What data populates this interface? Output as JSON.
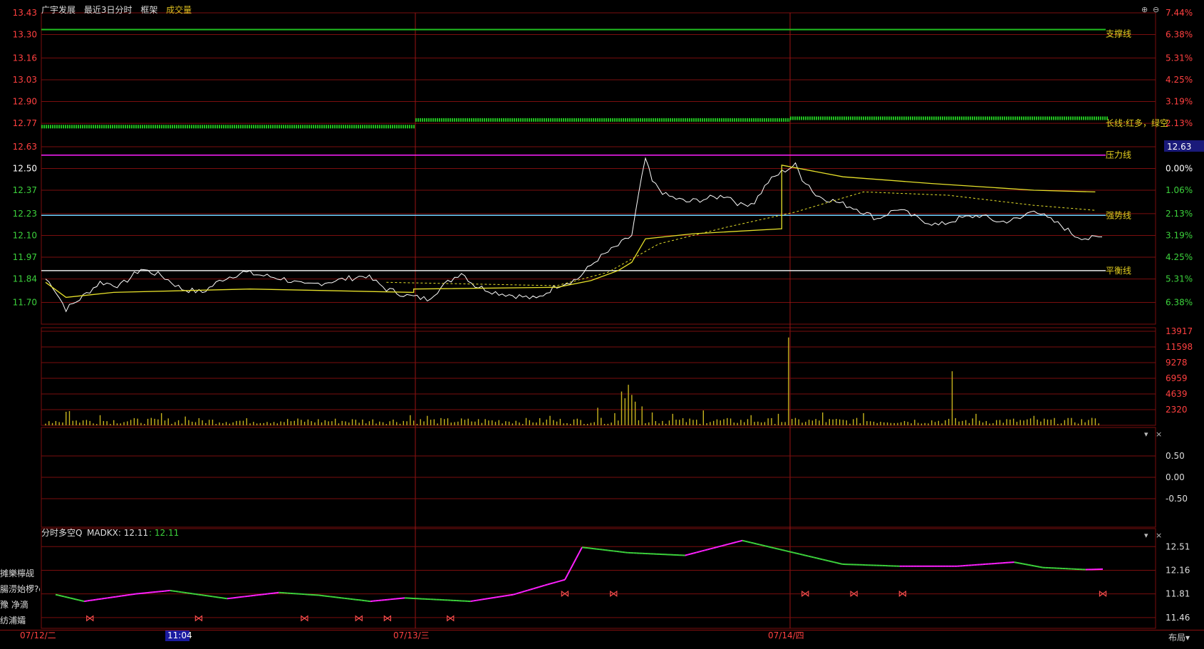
{
  "header": {
    "stock_name": "广宇发展",
    "period": "最近3日分时",
    "frame": "框架",
    "indicator": "成交量",
    "indicator_color": "#e0c020"
  },
  "colors": {
    "up": "#ff4040",
    "down": "#3cd23c",
    "grid": "#7a0e0e",
    "price_line": "#ffffff",
    "avg_line": "#e6e02a",
    "support": "#20c020",
    "pressure": "#ff20ff",
    "strong": "#70d0ff",
    "balance": "#e8e8e8",
    "volume": "#c8b41e"
  },
  "chart_data": [
    {
      "type": "line",
      "name": "price-panel",
      "x_labels": [
        "07/12/二",
        "07/13/三",
        "07/14/四"
      ],
      "crosshair_time": "11:04",
      "left_ticks": [
        "13.43",
        "13.30",
        "13.16",
        "13.03",
        "12.90",
        "12.77",
        "12.63",
        "12.50",
        "12.37",
        "12.23",
        "12.10",
        "11.97",
        "11.84",
        "11.70"
      ],
      "right_ticks": [
        "7.44%",
        "6.38%",
        "5.31%",
        "4.25%",
        "3.19%",
        "2.13%",
        "1.06%",
        "0.00%",
        "1.06%",
        "2.13%",
        "3.19%",
        "4.25%",
        "5.31%",
        "6.38%"
      ],
      "ylim": [
        11.57,
        13.43
      ],
      "prev_close": 12.5,
      "current_price_label": "12.63",
      "hlines": [
        {
          "label": "支撑线",
          "value": 13.33
        },
        {
          "label": "长线:红多，绿空",
          "value": 12.77
        },
        {
          "label": "压力线",
          "value": 12.58
        },
        {
          "label": "强势线",
          "value": 12.22
        },
        {
          "label": "平衡线",
          "value": 11.89
        }
      ],
      "long_line_segments": [
        {
          "day": 0,
          "value": 12.75
        },
        {
          "day": 1,
          "value": 12.79
        },
        {
          "day": 2,
          "value": 12.8
        }
      ],
      "price_keypoints": [
        [
          0,
          11.84
        ],
        [
          2,
          11.8
        ],
        [
          6,
          11.66
        ],
        [
          10,
          11.72
        ],
        [
          16,
          11.82
        ],
        [
          22,
          11.8
        ],
        [
          28,
          11.9
        ],
        [
          34,
          11.86
        ],
        [
          40,
          11.78
        ],
        [
          46,
          11.76
        ],
        [
          52,
          11.84
        ],
        [
          58,
          11.88
        ],
        [
          64,
          11.86
        ],
        [
          70,
          11.84
        ],
        [
          76,
          11.8
        ],
        [
          82,
          11.82
        ],
        [
          88,
          11.84
        ],
        [
          94,
          11.86
        ],
        [
          100,
          11.78
        ],
        [
          106,
          11.74
        ],
        [
          112,
          11.72
        ],
        [
          118,
          11.82
        ],
        [
          122,
          11.88
        ],
        [
          126,
          11.8
        ],
        [
          132,
          11.76
        ],
        [
          138,
          11.74
        ],
        [
          144,
          11.72
        ],
        [
          150,
          11.8
        ],
        [
          156,
          11.84
        ],
        [
          162,
          11.96
        ],
        [
          168,
          12.04
        ],
        [
          172,
          12.1
        ],
        [
          174,
          12.34
        ],
        [
          176,
          12.56
        ],
        [
          178,
          12.42
        ],
        [
          182,
          12.34
        ],
        [
          188,
          12.3
        ],
        [
          194,
          12.32
        ],
        [
          200,
          12.34
        ],
        [
          204,
          12.28
        ],
        [
          208,
          12.3
        ],
        [
          212,
          12.42
        ],
        [
          216,
          12.48
        ],
        [
          220,
          12.52
        ],
        [
          222,
          12.44
        ],
        [
          224,
          12.4
        ],
        [
          226,
          12.34
        ],
        [
          232,
          12.3
        ],
        [
          238,
          12.26
        ],
        [
          244,
          12.2
        ],
        [
          250,
          12.26
        ],
        [
          256,
          12.2
        ],
        [
          262,
          12.16
        ],
        [
          268,
          12.2
        ],
        [
          274,
          12.22
        ],
        [
          280,
          12.18
        ],
        [
          286,
          12.2
        ],
        [
          290,
          12.26
        ],
        [
          294,
          12.2
        ],
        [
          298,
          12.16
        ],
        [
          302,
          12.1
        ],
        [
          306,
          12.08
        ],
        [
          310,
          12.09
        ]
      ],
      "avg_keypoints": [
        [
          0,
          11.82
        ],
        [
          6,
          11.73
        ],
        [
          20,
          11.76
        ],
        [
          60,
          11.78
        ],
        [
          108,
          11.76
        ],
        [
          108,
          11.78
        ],
        [
          150,
          11.79
        ],
        [
          160,
          11.83
        ],
        [
          168,
          11.89
        ],
        [
          172,
          11.94
        ],
        [
          176,
          12.08
        ],
        [
          190,
          12.11
        ],
        [
          216,
          12.14
        ],
        [
          216,
          12.52
        ],
        [
          234,
          12.45
        ],
        [
          260,
          12.41
        ],
        [
          290,
          12.37
        ],
        [
          308,
          12.36
        ]
      ],
      "avg_dashed_keypoints": [
        [
          100,
          11.82
        ],
        [
          150,
          11.8
        ],
        [
          165,
          11.88
        ],
        [
          180,
          12.05
        ],
        [
          200,
          12.15
        ],
        [
          220,
          12.24
        ],
        [
          240,
          12.36
        ],
        [
          265,
          12.34
        ],
        [
          290,
          12.28
        ],
        [
          308,
          12.25
        ]
      ]
    },
    {
      "type": "bar",
      "name": "volume-panel",
      "ticks": [
        13917,
        11598,
        9278,
        6959,
        4639,
        2320
      ],
      "ylim": [
        0,
        13917
      ],
      "spikes": [
        [
          6,
          2000
        ],
        [
          7,
          2100
        ],
        [
          16,
          1500
        ],
        [
          34,
          1800
        ],
        [
          41,
          1300
        ],
        [
          107,
          1500
        ],
        [
          112,
          1400
        ],
        [
          148,
          1400
        ],
        [
          162,
          2600
        ],
        [
          167,
          1800
        ],
        [
          169,
          5000
        ],
        [
          170,
          4000
        ],
        [
          171,
          6000
        ],
        [
          172,
          4500
        ],
        [
          173,
          3500
        ],
        [
          175,
          2800
        ],
        [
          178,
          1900
        ],
        [
          184,
          1700
        ],
        [
          193,
          2200
        ],
        [
          207,
          1500
        ],
        [
          215,
          1700
        ],
        [
          218,
          13000
        ],
        [
          228,
          1900
        ],
        [
          240,
          1800
        ],
        [
          266,
          8000
        ],
        [
          273,
          1700
        ],
        [
          290,
          1400
        ],
        [
          307,
          1100
        ]
      ]
    },
    {
      "type": "line",
      "name": "empty-panel",
      "ticks": [
        "0.50",
        "0.00",
        "-0.50"
      ]
    },
    {
      "type": "line",
      "name": "madkx-panel",
      "title": "分时多空Q",
      "label": "MADKX: 12.11",
      "value_label": ": 12.11",
      "ticks": [
        "12.51",
        "12.16",
        "11.81",
        "11.46"
      ],
      "ylim": [
        11.3,
        12.65
      ],
      "curve_keypoints": [
        [
          0,
          11.8
        ],
        [
          10,
          11.7
        ],
        [
          28,
          11.81
        ],
        [
          40,
          11.86
        ],
        [
          60,
          11.74
        ],
        [
          78,
          11.83
        ],
        [
          92,
          11.79
        ],
        [
          110,
          11.7
        ],
        [
          122,
          11.75
        ],
        [
          145,
          11.7
        ],
        [
          160,
          11.8
        ],
        [
          172,
          11.95
        ],
        [
          178,
          12.02
        ],
        [
          184,
          12.5
        ],
        [
          200,
          12.42
        ],
        [
          220,
          12.38
        ],
        [
          240,
          12.6
        ],
        [
          260,
          12.4
        ],
        [
          275,
          12.25
        ],
        [
          295,
          12.22
        ],
        [
          315,
          12.22
        ],
        [
          335,
          12.28
        ],
        [
          345,
          12.2
        ],
        [
          360,
          12.17
        ]
      ],
      "butterflies_low": [
        12,
        50,
        87,
        106,
        116,
        138
      ],
      "butterflies_high": [
        178,
        195,
        262,
        279,
        296,
        366
      ]
    }
  ],
  "side_panel": {
    "rows": [
      "摊樂檸觇",
      "腸涝始椤?c",
      "豫  净滴",
      "纺浦孀"
    ]
  },
  "bottom_bar": {
    "layout_button": "布局"
  }
}
